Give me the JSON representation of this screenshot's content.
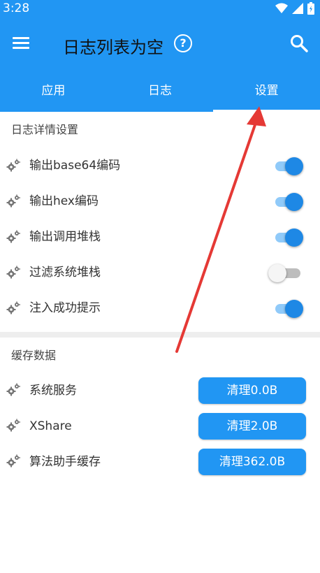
{
  "status_bar": {
    "time": "3:28"
  },
  "toolbar": {
    "title": "日志列表为空",
    "help_glyph": "?"
  },
  "tabs": [
    {
      "label": "应用",
      "active": false
    },
    {
      "label": "日志",
      "active": false
    },
    {
      "label": "设置",
      "active": true
    }
  ],
  "log_settings": {
    "section_title": "日志详情设置",
    "items": [
      {
        "label": "输出base64编码",
        "enabled": true
      },
      {
        "label": "输出hex编码",
        "enabled": true
      },
      {
        "label": "输出调用堆栈",
        "enabled": true
      },
      {
        "label": "过滤系统堆栈",
        "enabled": false
      },
      {
        "label": "注入成功提示",
        "enabled": true
      }
    ]
  },
  "cache": {
    "section_title": "缓存数据",
    "items": [
      {
        "label": "系统服务",
        "button": "清理0.0B"
      },
      {
        "label": "XShare",
        "button": "清理2.0B"
      },
      {
        "label": "算法助手缓存",
        "button": "清理362.0B"
      }
    ]
  },
  "colors": {
    "primary": "#2196F3",
    "switch_on": "#1E88E5",
    "annotation_arrow": "#E53935"
  },
  "icons": {
    "menu": "hamburger-menu-icon",
    "help": "help-circle-icon",
    "search": "search-icon",
    "row": "gear-icon"
  }
}
